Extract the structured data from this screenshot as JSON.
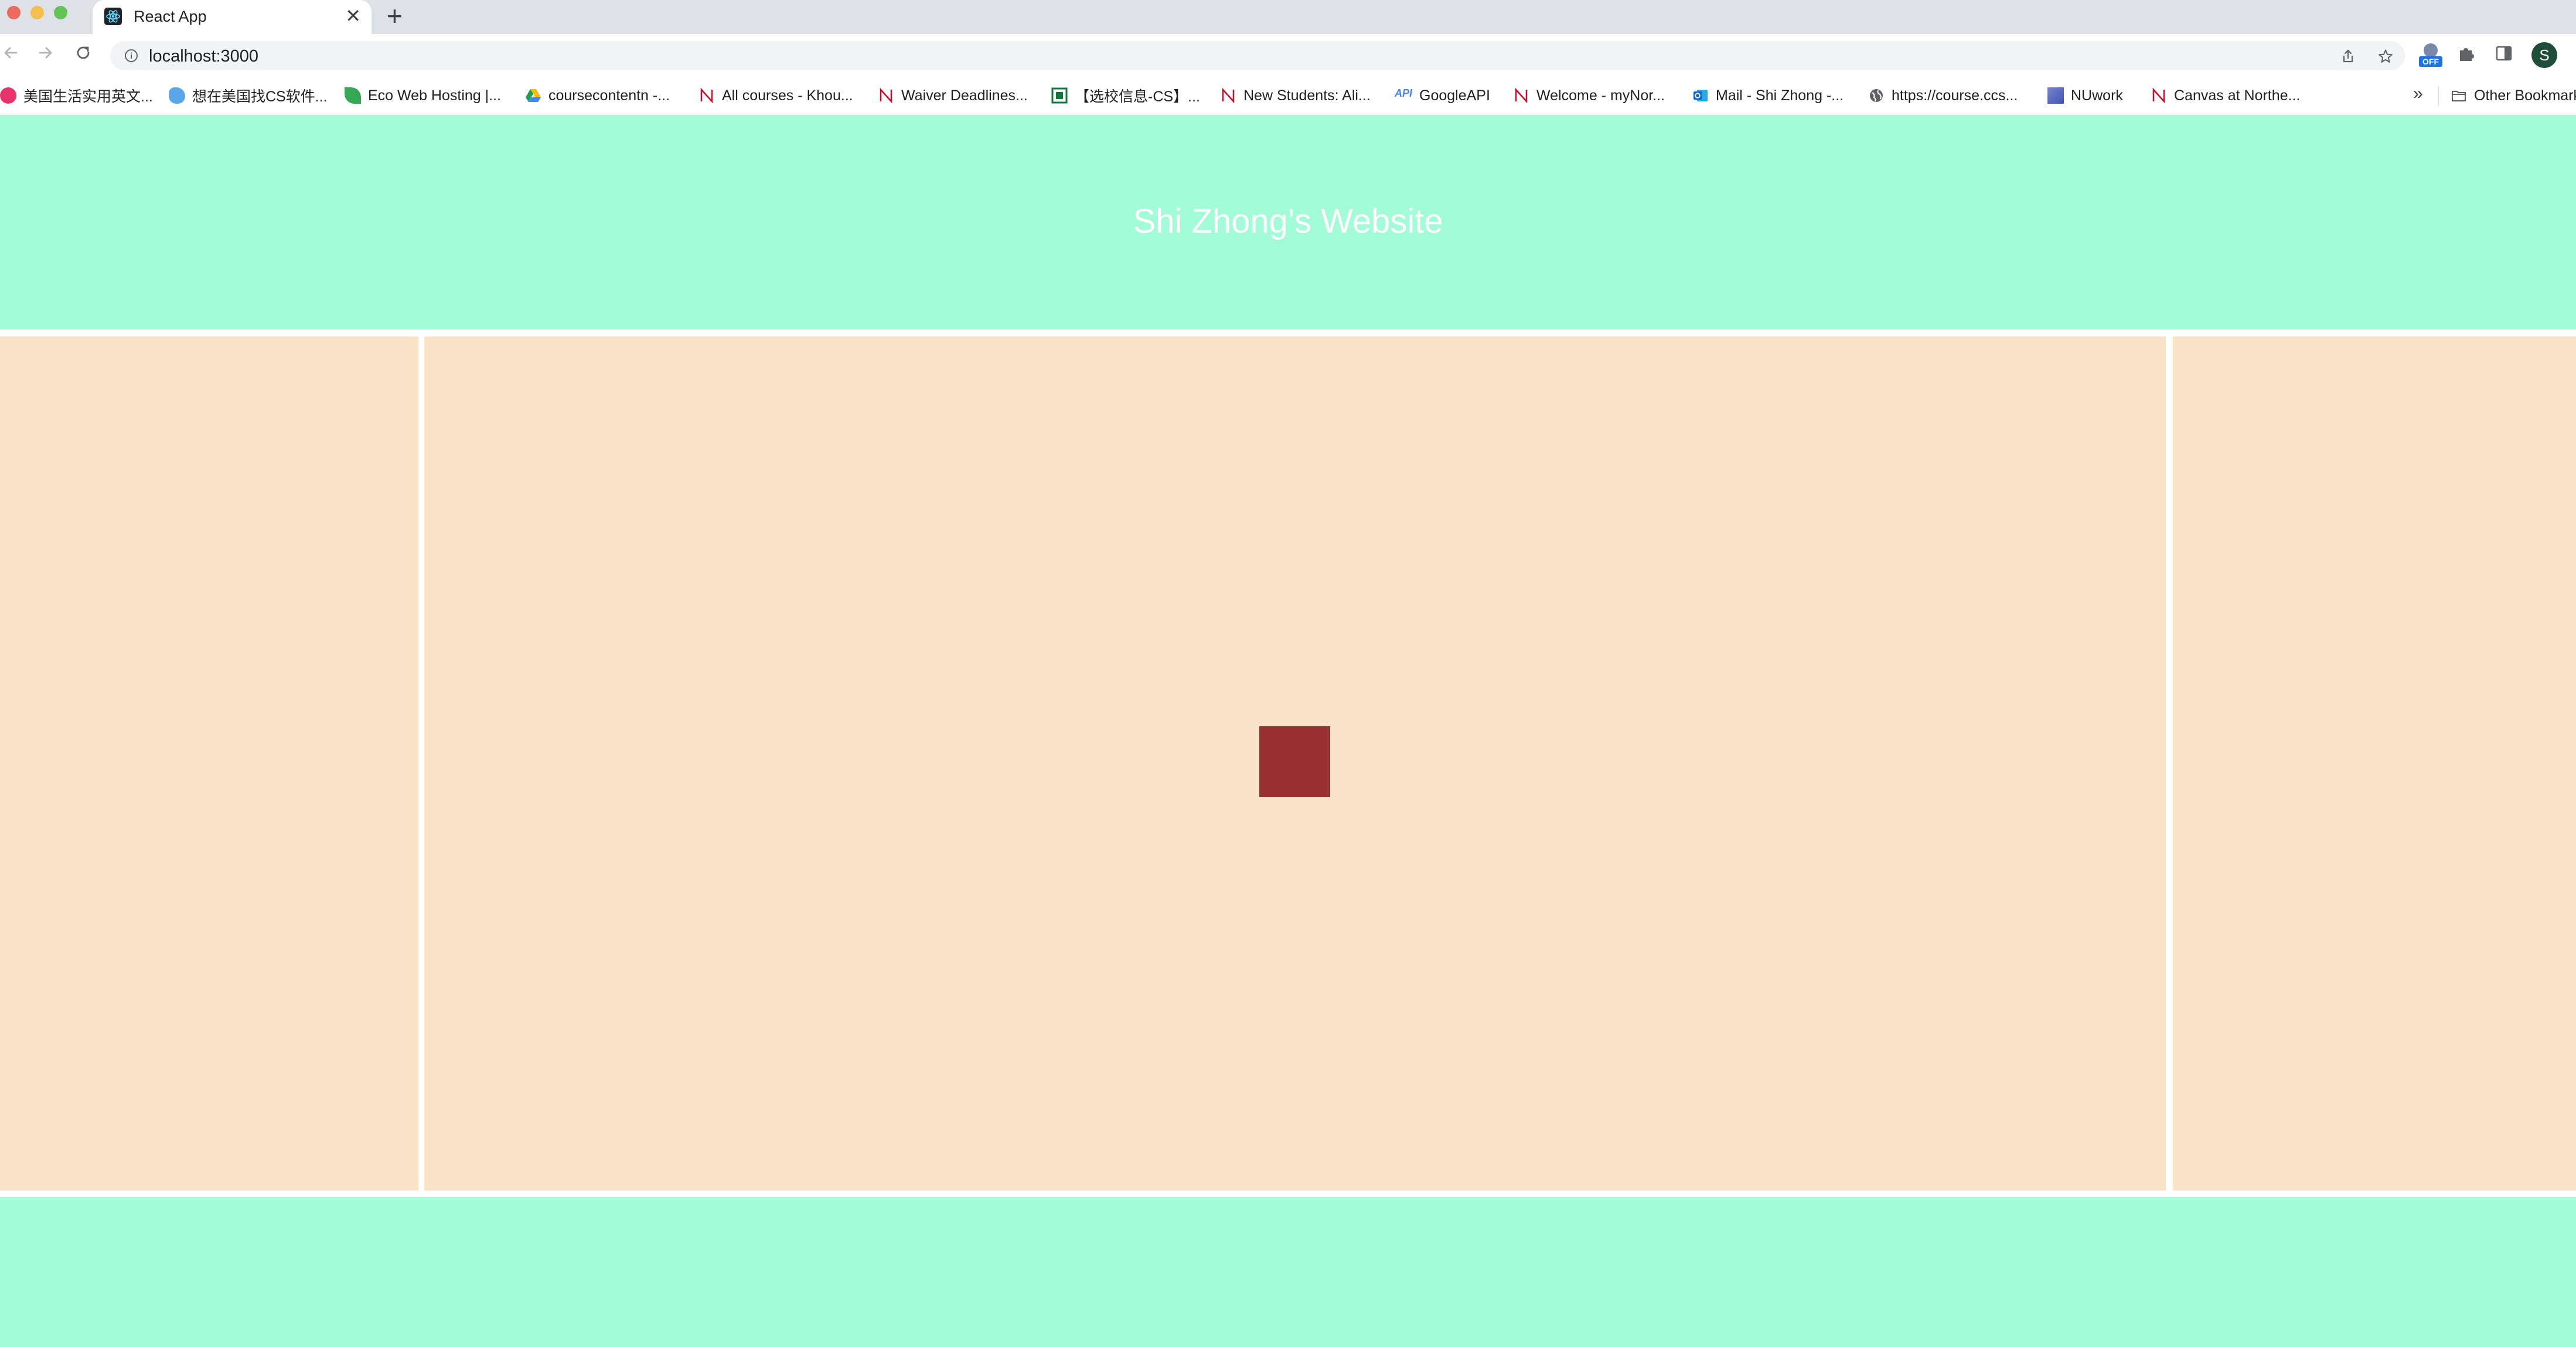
{
  "browser": {
    "tab": {
      "title": "React App",
      "favicon": "react-icon",
      "close_glyph": "✕"
    },
    "new_tab_glyph": "+",
    "address": {
      "url": "localhost:3000"
    },
    "profile_initial": "S",
    "extension_badge": "OFF"
  },
  "bookmarks": [
    {
      "label": "美国生活实用英文...",
      "icon": "bookmark-red-flower-icon",
      "color": "#e8336d"
    },
    {
      "label": "想在美国找CS软件...",
      "icon": "bookmark-bird-icon",
      "color": "#1a73e8"
    },
    {
      "label": "Eco Web Hosting |...",
      "icon": "bookmark-leaf-icon",
      "color": "#34a853"
    },
    {
      "label": "coursecontentn -...",
      "icon": "google-drive-icon",
      "color": "#fbbc04"
    },
    {
      "label": "All courses - Khou...",
      "icon": "northeastern-n-icon",
      "color": "#c8102e"
    },
    {
      "label": "Waiver Deadlines...",
      "icon": "northeastern-n-icon",
      "color": "#c8102e"
    },
    {
      "label": "【选校信息-CS】...",
      "icon": "bookmark-green-square-icon",
      "color": "#0f7b3a"
    },
    {
      "label": "New Students: Ali...",
      "icon": "northeastern-n-icon",
      "color": "#c8102e"
    },
    {
      "label": "GoogleAPI",
      "icon": "api-icon",
      "color": "#4285f4"
    },
    {
      "label": "Welcome - myNor...",
      "icon": "northeastern-n-icon",
      "color": "#c8102e"
    },
    {
      "label": "Mail - Shi Zhong -...",
      "icon": "outlook-icon",
      "color": "#0a64c8"
    },
    {
      "label": "https://course.ccs...",
      "icon": "globe-icon",
      "color": "#5f6368"
    },
    {
      "label": "NUwork",
      "icon": "nuwork-icon",
      "color": "#3f51b5"
    },
    {
      "label": "Canvas at Northe...",
      "icon": "northeastern-n-icon",
      "color": "#c8102e"
    }
  ],
  "bookmarks_more_glyph": "»",
  "other_bookmarks": {
    "label": "Other Bookmarks",
    "icon": "folder-icon"
  },
  "page": {
    "header": {
      "title": "Shi Zhong's Website"
    },
    "colors": {
      "header_bg": "#a2fcd8",
      "panel_bg": "#fae3c7",
      "square": "#993131"
    }
  }
}
